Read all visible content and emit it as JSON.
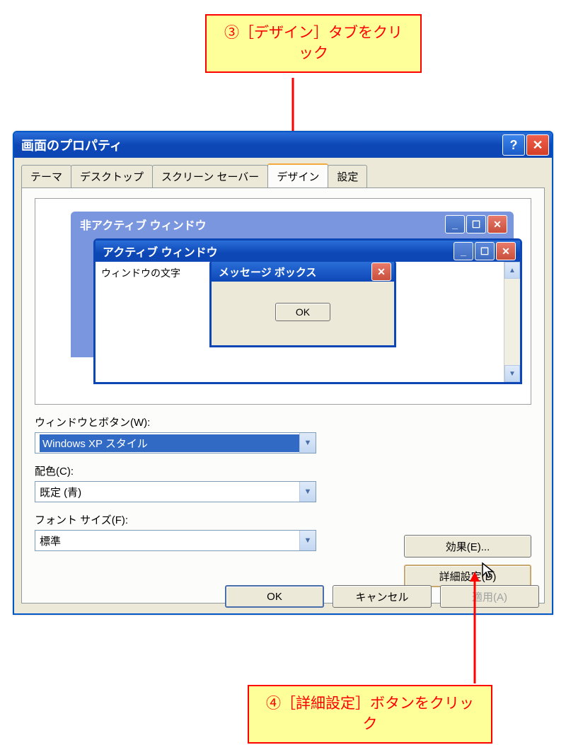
{
  "callouts": {
    "top": "③［デザイン］タブをクリック",
    "bottom": "④［詳細設定］ボタンをクリック"
  },
  "dialog": {
    "title": "画面のプロパティ",
    "tabs": {
      "theme": "テーマ",
      "desktop": "デスクトップ",
      "screensaver": "スクリーン セーバー",
      "design": "デザイン",
      "settings": "設定"
    },
    "preview": {
      "inactive_title": "非アクティブ ウィンドウ",
      "active_title": "アクティブ ウィンドウ",
      "window_text": "ウィンドウの文字",
      "msgbox_title": "メッセージ ボックス",
      "msgbox_ok": "OK"
    },
    "form": {
      "windows_buttons_label": "ウィンドウとボタン(W):",
      "windows_buttons_value": "Windows XP スタイル",
      "color_label": "配色(C):",
      "color_value": "既定 (青)",
      "font_label": "フォント サイズ(F):",
      "font_value": "標準",
      "effects_btn": "効果(E)...",
      "advanced_btn": "詳細設定(D)"
    },
    "buttons": {
      "ok": "OK",
      "cancel": "キャンセル",
      "apply": "適用(A)"
    }
  }
}
